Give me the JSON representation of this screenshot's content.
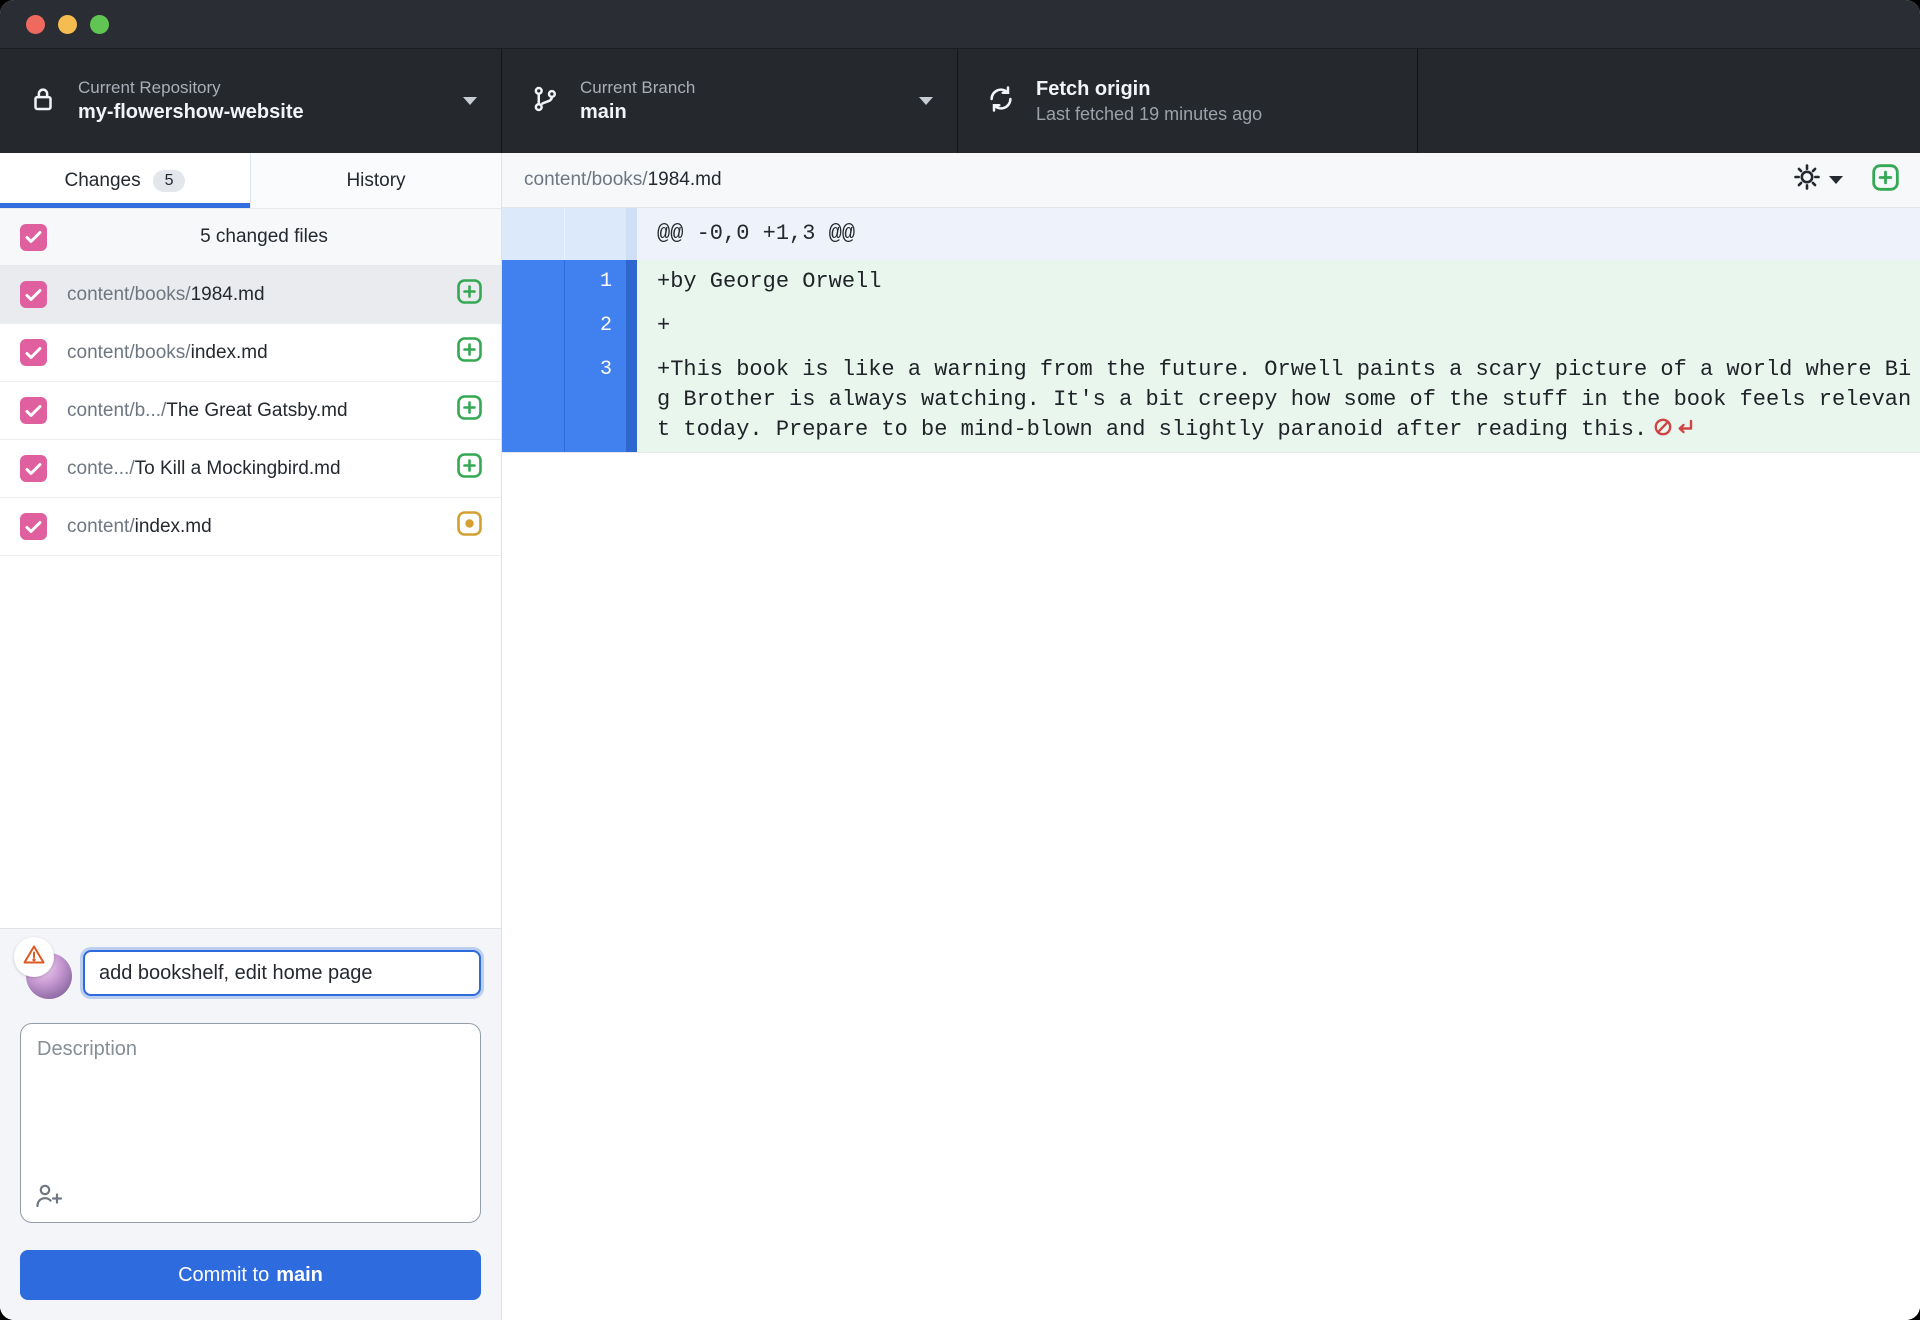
{
  "toolbar": {
    "repository": {
      "label": "Current Repository",
      "value": "my-flowershow-website"
    },
    "branch": {
      "label": "Current Branch",
      "value": "main"
    },
    "fetch": {
      "title": "Fetch origin",
      "subtitle": "Last fetched 19 minutes ago"
    }
  },
  "sidebar": {
    "tabs": [
      {
        "label": "Changes",
        "badge": "5"
      },
      {
        "label": "History"
      }
    ],
    "select_all_label": "5 changed files",
    "files": [
      {
        "dir": "content/books/",
        "name": "1984.md",
        "status": "added",
        "checked": true,
        "selected": true
      },
      {
        "dir": "content/books/",
        "name": "index.md",
        "status": "added",
        "checked": true
      },
      {
        "dir": "content/b.../",
        "name": "The Great Gatsby.md",
        "status": "added",
        "checked": true
      },
      {
        "dir": "conte.../",
        "name": "To Kill a Mockingbird.md",
        "status": "added",
        "checked": true
      },
      {
        "dir": "content/",
        "name": "index.md",
        "status": "modified",
        "checked": true
      }
    ],
    "commit": {
      "summary_value": "add bookshelf, edit home page",
      "description_placeholder": "Description",
      "button_prefix": "Commit to",
      "button_branch": "main"
    }
  },
  "diff": {
    "file_header": {
      "dir": "content/books/",
      "name": "1984.md"
    },
    "hunk_header": "@@ -0,0 +1,3 @@",
    "lines": [
      {
        "new_line": "1",
        "text": "+by George Orwell"
      },
      {
        "new_line": "2",
        "text": "+"
      },
      {
        "new_line": "3",
        "text": "+This book is like a warning from the future. Orwell paints a scary picture of a world where Big Brother is always watching. It's a bit creepy how some of the stuff in the book feels relevant today. Prepare to be mind-blown and slightly paranoid after reading this.",
        "end_marker": "no-newline-at-end-of-file"
      }
    ]
  },
  "colors": {
    "accent_blue": "#2e6bdf",
    "checkbox_pink": "#e0609f",
    "added_green": "#34a853",
    "modified_yellow": "#d4a032",
    "no_newline_red": "#cf4444",
    "gutter_blue": "#4080ef",
    "added_bg": "#e9f6ee",
    "toolbar_bg": "#25282d"
  }
}
